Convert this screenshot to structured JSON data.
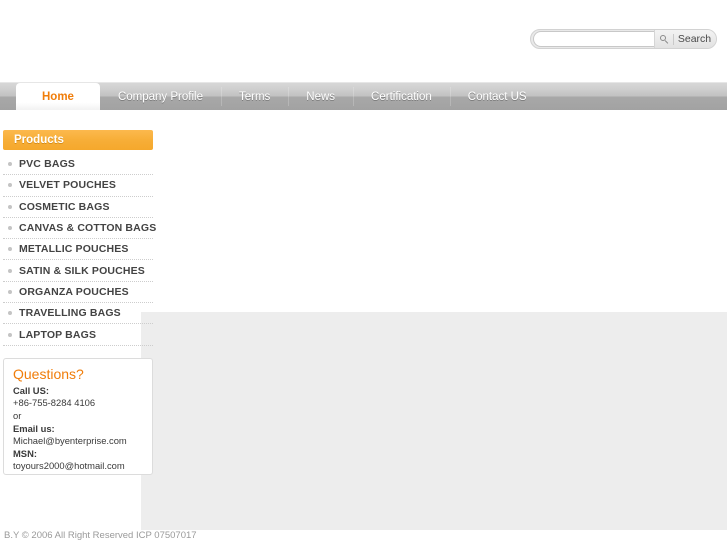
{
  "search": {
    "value": "",
    "placeholder": "",
    "button_label": "Search",
    "icon": "search-icon"
  },
  "nav": {
    "items": [
      {
        "label": "Home",
        "active": true
      },
      {
        "label": "Company Profile",
        "active": false
      },
      {
        "label": "Terms",
        "active": false
      },
      {
        "label": "News",
        "active": false
      },
      {
        "label": "Certification",
        "active": false
      },
      {
        "label": "Contact US",
        "active": false
      }
    ]
  },
  "sidebar": {
    "products_header": "Products",
    "products": [
      {
        "label": "PVC BAGS"
      },
      {
        "label": "VELVET POUCHES"
      },
      {
        "label": "COSMETIC BAGS"
      },
      {
        "label": "CANVAS & COTTON BAGS"
      },
      {
        "label": "METALLIC POUCHES"
      },
      {
        "label": "SATIN & SILK POUCHES"
      },
      {
        "label": "ORGANZA POUCHES"
      },
      {
        "label": "TRAVELLING BAGS"
      },
      {
        "label": "LAPTOP BAGS"
      }
    ],
    "questions": {
      "title": "Questions?",
      "call_label": "Call US:",
      "phone": "+86-755-8284 4106",
      "or": "or",
      "email_label": "Email us:",
      "email": "Michael@byenterprise.com",
      "msn_label": "MSN:",
      "msn": "toyours2000@hotmail.com"
    }
  },
  "footer": {
    "text": "B.Y © 2006 All Right Reserved  ICP 07507017"
  },
  "colors": {
    "accent_orange": "#f07d0a",
    "products_bar": "#f7ae38",
    "nav_gray": "#b4b4b4",
    "content_gray": "#ededed"
  }
}
